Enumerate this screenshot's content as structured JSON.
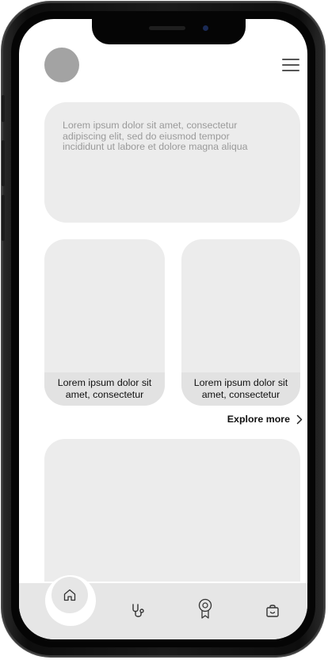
{
  "hero": {
    "text": "Lorem ipsum dolor sit amet, consectetur adipiscing elit, sed do eiusmod tempor incididunt ut labore et dolore magna aliqua"
  },
  "cards": [
    {
      "caption": "Lorem ipsum dolor sit amet, consectetur"
    },
    {
      "caption": "Lorem ipsum dolor sit amet, consectetur"
    }
  ],
  "explore": {
    "label": "Explore more"
  },
  "header": {
    "avatar_icon": "avatar",
    "menu_icon": "hamburger-menu-icon"
  },
  "tabbar": {
    "items": [
      {
        "icon": "home-icon",
        "active": true
      },
      {
        "icon": "stethoscope-icon",
        "active": false
      },
      {
        "icon": "award-badge-icon",
        "active": false
      },
      {
        "icon": "shopping-bag-icon",
        "active": false
      }
    ]
  },
  "colors": {
    "card_bg": "#ececec",
    "caption_bg": "#e2e2e2",
    "avatar": "#a3a3a3",
    "tabbar_bg": "#e6e6e6",
    "hero_text": "#9a9a9a"
  }
}
